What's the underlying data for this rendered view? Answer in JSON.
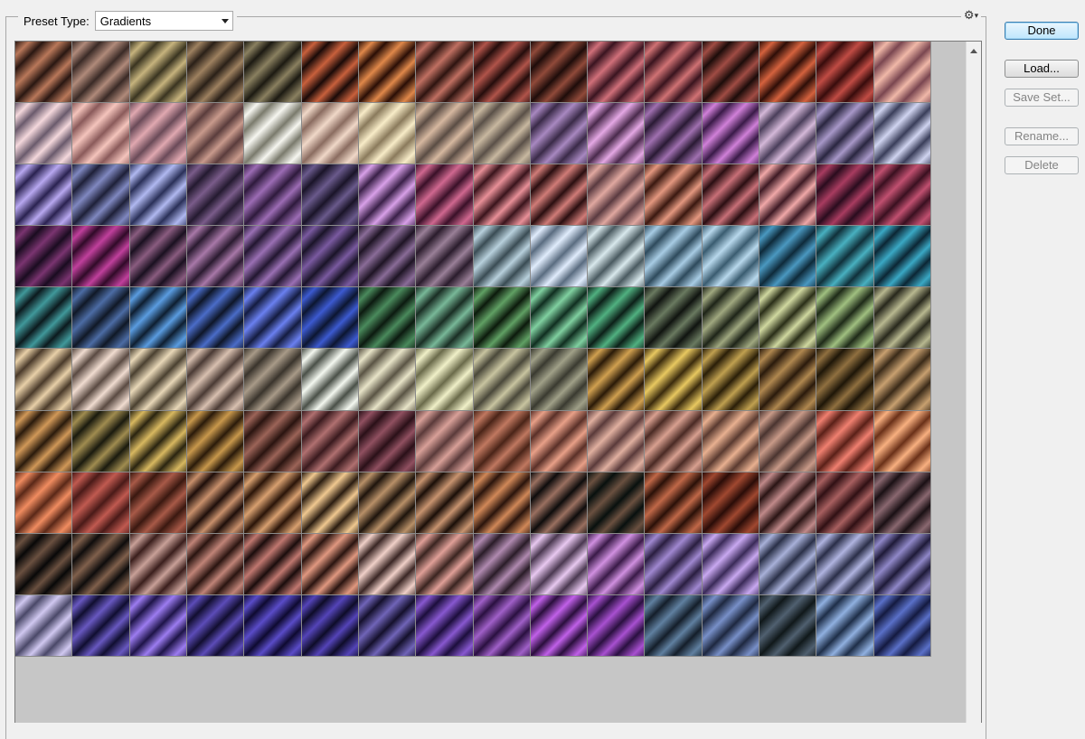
{
  "preset": {
    "label": "Preset Type:",
    "value": "Gradients",
    "options": [
      "Gradients"
    ]
  },
  "menu_icon": "gear-icon",
  "buttons": {
    "done": "Done",
    "load": "Load...",
    "save_set": "Save Set...",
    "rename": "Rename...",
    "delete": "Delete"
  },
  "colors": {
    "panel_bg": "#f0f0f0",
    "viewport_bg": "#c6c6c6",
    "default_button_border": "#3c7fb1"
  },
  "swatch_rows": [
    [
      [
        "#2a1712",
        "#b9785a"
      ],
      [
        "#3a2a26",
        "#b08a7a"
      ],
      [
        "#3a3420",
        "#c6b37d"
      ],
      [
        "#2a2018",
        "#9e8160"
      ],
      [
        "#1c1a12",
        "#8a8060"
      ],
      [
        "#1a0a08",
        "#c8603c"
      ],
      [
        "#2a0e06",
        "#e0884a"
      ],
      [
        "#2e1410",
        "#c07062"
      ],
      [
        "#250d0c",
        "#b0544a"
      ],
      [
        "#1e0c0a",
        "#904a3a"
      ],
      [
        "#3a1420",
        "#d0707a"
      ],
      [
        "#3a141e",
        "#d07274"
      ],
      [
        "#1c0c0a",
        "#a04c44"
      ],
      [
        "#2e0e08",
        "#d4623e"
      ],
      [
        "#380c0c",
        "#c04c44"
      ],
      [
        "#7a4650",
        "#f0b8a8"
      ]
    ],
    [
      [
        "#6a5a6c",
        "#f4d8dc"
      ],
      [
        "#8a5a5a",
        "#f4c4bc"
      ],
      [
        "#6a4a58",
        "#e0a8b0"
      ],
      [
        "#5a3c3c",
        "#c89a8c"
      ],
      [
        "#7a7a6c",
        "#f6f6f0"
      ],
      [
        "#8a6c60",
        "#f0d8c8"
      ],
      [
        "#8a7a5c",
        "#f8ecc8"
      ],
      [
        "#5a4c44",
        "#d6b8a0"
      ],
      [
        "#5a5048",
        "#c8b8a0"
      ],
      [
        "#3a2a48",
        "#a888c0"
      ],
      [
        "#4a2a4c",
        "#e4a8e4"
      ],
      [
        "#2a1a34",
        "#a070b0"
      ],
      [
        "#3a1a48",
        "#d080d8"
      ],
      [
        "#4a3e5a",
        "#d4b8d8"
      ],
      [
        "#2a2640",
        "#a898c8"
      ],
      [
        "#3a3e5a",
        "#d0d4f0"
      ]
    ],
    [
      [
        "#2a2250",
        "#b8a8f0"
      ],
      [
        "#1e2038",
        "#8088c0"
      ],
      [
        "#2a3058",
        "#b0b8f0"
      ],
      [
        "#241a30",
        "#7a5c8a"
      ],
      [
        "#2e1a3c",
        "#9c6cb4"
      ],
      [
        "#1a1428",
        "#6a5a8c"
      ],
      [
        "#3a2048",
        "#d8a0e8"
      ],
      [
        "#3a1028",
        "#d06890"
      ],
      [
        "#3a141c",
        "#e89098"
      ],
      [
        "#2a0e10",
        "#d07c78"
      ],
      [
        "#5a3a40",
        "#e0a8a0"
      ],
      [
        "#3a1810",
        "#e49880"
      ],
      [
        "#2a0e12",
        "#c87078"
      ],
      [
        "#3e1a24",
        "#f0a8a8"
      ],
      [
        "#2a0c1e",
        "#a83c60"
      ],
      [
        "#3a1020",
        "#c05070"
      ]
    ],
    [
      [
        "#1a0c20",
        "#7a3470"
      ],
      [
        "#300a28",
        "#c0409c"
      ],
      [
        "#1a1020",
        "#8a5c80"
      ],
      [
        "#2a1a30",
        "#a878a8"
      ],
      [
        "#221630",
        "#9a70b4"
      ],
      [
        "#1a1428",
        "#7a5aa0"
      ],
      [
        "#1e1424",
        "#8a6c98"
      ],
      [
        "#2a1c2c",
        "#9a8098"
      ],
      [
        "#3a4c54",
        "#b8d0dc"
      ],
      [
        "#5a6c80",
        "#e0ecfc"
      ],
      [
        "#4a5a60",
        "#d8e8ec"
      ],
      [
        "#2e4a5c",
        "#a8cce4"
      ],
      [
        "#3a5c70",
        "#b8d8ec"
      ],
      [
        "#0e2a3a",
        "#4a98c0"
      ],
      [
        "#10303a",
        "#48b0c0"
      ],
      [
        "#0c2634",
        "#3aa8c4"
      ]
    ],
    [
      [
        "#0c1a1e",
        "#40989a"
      ],
      [
        "#101826",
        "#4c6ca4"
      ],
      [
        "#0e1e30",
        "#5a9ce0"
      ],
      [
        "#0e1628",
        "#4a6cc8"
      ],
      [
        "#141c40",
        "#6a80f0"
      ],
      [
        "#0c1630",
        "#3c5ad0"
      ],
      [
        "#0c1a10",
        "#4a8a5c"
      ],
      [
        "#1a2e24",
        "#78b898"
      ],
      [
        "#0c1a0c",
        "#60a064"
      ],
      [
        "#102e20",
        "#80d0a0"
      ],
      [
        "#0c2018",
        "#50b080"
      ],
      [
        "#101410",
        "#6a7a60"
      ],
      [
        "#1e2418",
        "#a0a880"
      ],
      [
        "#2a2e18",
        "#d0d8a0"
      ],
      [
        "#1e2a18",
        "#a0c080"
      ],
      [
        "#28281c",
        "#b8b890"
      ]
    ],
    [
      [
        "#4a3a2a",
        "#e8d0a8"
      ],
      [
        "#5a4a42",
        "#f0dcd0"
      ],
      [
        "#4a4030",
        "#e8d8b8"
      ],
      [
        "#4a3a34",
        "#d8c0b0"
      ],
      [
        "#3a342c",
        "#a89a88"
      ],
      [
        "#4a5048",
        "#f4f8f0"
      ],
      [
        "#5a5444",
        "#e8e4c8"
      ],
      [
        "#6a6a4a",
        "#f0f0c8"
      ],
      [
        "#4a483a",
        "#c8c4a0"
      ],
      [
        "#3a3a30",
        "#a0a088"
      ],
      [
        "#2a1a08",
        "#d0a050"
      ],
      [
        "#3a2a0c",
        "#e8c860"
      ],
      [
        "#2a1e08",
        "#c0a050"
      ],
      [
        "#2a1a0c",
        "#b08850"
      ],
      [
        "#1e1608",
        "#907040"
      ],
      [
        "#3a2a18",
        "#c8a070"
      ]
    ],
    [
      [
        "#2a1a0c",
        "#d09858"
      ],
      [
        "#1a1a0e",
        "#a08c50"
      ],
      [
        "#2a2410",
        "#d8b860"
      ],
      [
        "#2a1a0a",
        "#c8984c"
      ],
      [
        "#2a1410",
        "#9c6458"
      ],
      [
        "#3a1a1e",
        "#b07070"
      ],
      [
        "#2a1018",
        "#905060"
      ],
      [
        "#5a3a3a",
        "#d8a098"
      ],
      [
        "#4a2418",
        "#c07860"
      ],
      [
        "#5a3028",
        "#e8a088"
      ],
      [
        "#5a3a3a",
        "#e0b0a0"
      ],
      [
        "#4a2a24",
        "#d8a090"
      ],
      [
        "#5a3a30",
        "#e8b090"
      ],
      [
        "#4a3430",
        "#c89a88"
      ],
      [
        "#5a2018",
        "#f08070"
      ],
      [
        "#6a3018",
        "#f8b080"
      ]
    ],
    [
      [
        "#5a2818",
        "#f08c60"
      ],
      [
        "#4a1a18",
        "#c05a50"
      ],
      [
        "#3a1810",
        "#a85a48"
      ],
      [
        "#1e0e0a",
        "#c8906c"
      ],
      [
        "#2a1408",
        "#d8a070"
      ],
      [
        "#2a1c10",
        "#f0c890"
      ],
      [
        "#1e140c",
        "#b89068"
      ],
      [
        "#1a0e08",
        "#c89470"
      ],
      [
        "#2a140c",
        "#d08858"
      ],
      [
        "#0e0c0c",
        "#9a7060"
      ],
      [
        "#08100e",
        "#6a5040"
      ],
      [
        "#2a1008",
        "#c06848"
      ],
      [
        "#2a0c08",
        "#a04830"
      ],
      [
        "#2a1414",
        "#c08a8a"
      ],
      [
        "#301014",
        "#a86060"
      ],
      [
        "#1a1014",
        "#8a6870"
      ]
    ],
    [
      [
        "#080808",
        "#6a5040"
      ],
      [
        "#0e0c0c",
        "#80604c"
      ],
      [
        "#3a1e1c",
        "#c8a098"
      ],
      [
        "#2a1410",
        "#c08478"
      ],
      [
        "#1a0c0c",
        "#c07870"
      ],
      [
        "#2a1410",
        "#e09880"
      ],
      [
        "#3a2624",
        "#f0d0c8"
      ],
      [
        "#3a2420",
        "#e0a098"
      ],
      [
        "#2a1c28",
        "#b08ab0"
      ],
      [
        "#4a3850",
        "#e8c8f0"
      ],
      [
        "#3a1a48",
        "#d090e0"
      ],
      [
        "#2a1e40",
        "#a088d0"
      ],
      [
        "#3a2a58",
        "#c8a8f0"
      ],
      [
        "#2a3048",
        "#a8b0d8"
      ],
      [
        "#2a2e48",
        "#b0b4e0"
      ],
      [
        "#1e1a38",
        "#9088c8"
      ]
    ],
    [
      [
        "#4a4868",
        "#d0c8f0"
      ],
      [
        "#100e30",
        "#6858c0"
      ],
      [
        "#1e1448",
        "#9c7cf0"
      ],
      [
        "#120e30",
        "#5c4cb8"
      ],
      [
        "#0e0a30",
        "#5a4cc8"
      ],
      [
        "#0e0c28",
        "#5444b8"
      ],
      [
        "#14102c",
        "#7064b8"
      ],
      [
        "#1c0e3c",
        "#8858d0"
      ],
      [
        "#2a1040",
        "#a060c8"
      ],
      [
        "#2a0e3c",
        "#c060e8"
      ],
      [
        "#2a1040",
        "#a850d0"
      ],
      [
        "#141e2a",
        "#6080a0"
      ],
      [
        "#1e2840",
        "#7890c8"
      ],
      [
        "#10181a",
        "#506070"
      ],
      [
        "#1e2e48",
        "#90b0e0"
      ],
      [
        "#141a40",
        "#5a70c8"
      ]
    ]
  ]
}
